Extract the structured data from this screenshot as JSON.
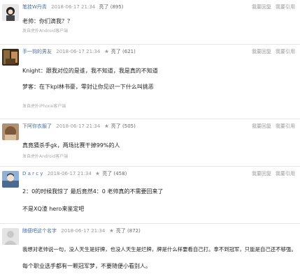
{
  "actions": {
    "reply": "我要回复",
    "quote": "我要引用"
  },
  "comments": [
    {
      "username": "笔挂W丹青",
      "timestamp": "2018-06-17 21:34",
      "like_label": "亮了",
      "like_count": "(895)",
      "lines": [
        "老帅：你们滴我？？"
      ],
      "device": "发自虎扑Android客户端"
    },
    {
      "username": "手一钩的男友",
      "timestamp": "2018-06-17 21:34",
      "like_label": "亮了",
      "like_count": "(621)",
      "lines": [
        "Knight：跟我对位的是谁，我不知道，我是真的不知道",
        "梦客：在下kpl林书豪，零封让你见识一下什么叫挑恶"
      ],
      "device": "发自虎扑iPhone客户端"
    },
    {
      "username": "下阿你衣服了",
      "timestamp": "2018-06-17 21:34",
      "like_label": "亮了",
      "like_count": "(505)",
      "lines": [
        "真竟猜杀手gk，两场比赛干掉99%的人"
      ],
      "device": "发自虎扑Android客户端"
    },
    {
      "username": "D a r c y",
      "timestamp": "2018-06-17 21:34",
      "like_label": "亮了",
      "like_count": "(458)",
      "lines": [
        "2：0的时候我惊了 最后竟然4：0 老帅真的不需要回来了",
        "不是XQ渣 hero来鉴定吧"
      ],
      "device": ""
    },
    {
      "username": "随便吧这个名字",
      "timestamp": "2018-06-17 21:34",
      "like_label": "亮了",
      "like_count": "(872)",
      "lines": [
        "我想对老帅说一句，没人天生是好牌，也没人天生是烂牌，牌是什么样要看自己打。拿不到冠军，只能是自己还不够强。",
        "每个职业选手都有一颗冠军梦，不要随便小看别人。"
      ],
      "device": ""
    }
  ],
  "colors": {
    "username_link": "#4a6fa5",
    "meta_gray": "#999999",
    "divider": "#e6e6e6"
  }
}
